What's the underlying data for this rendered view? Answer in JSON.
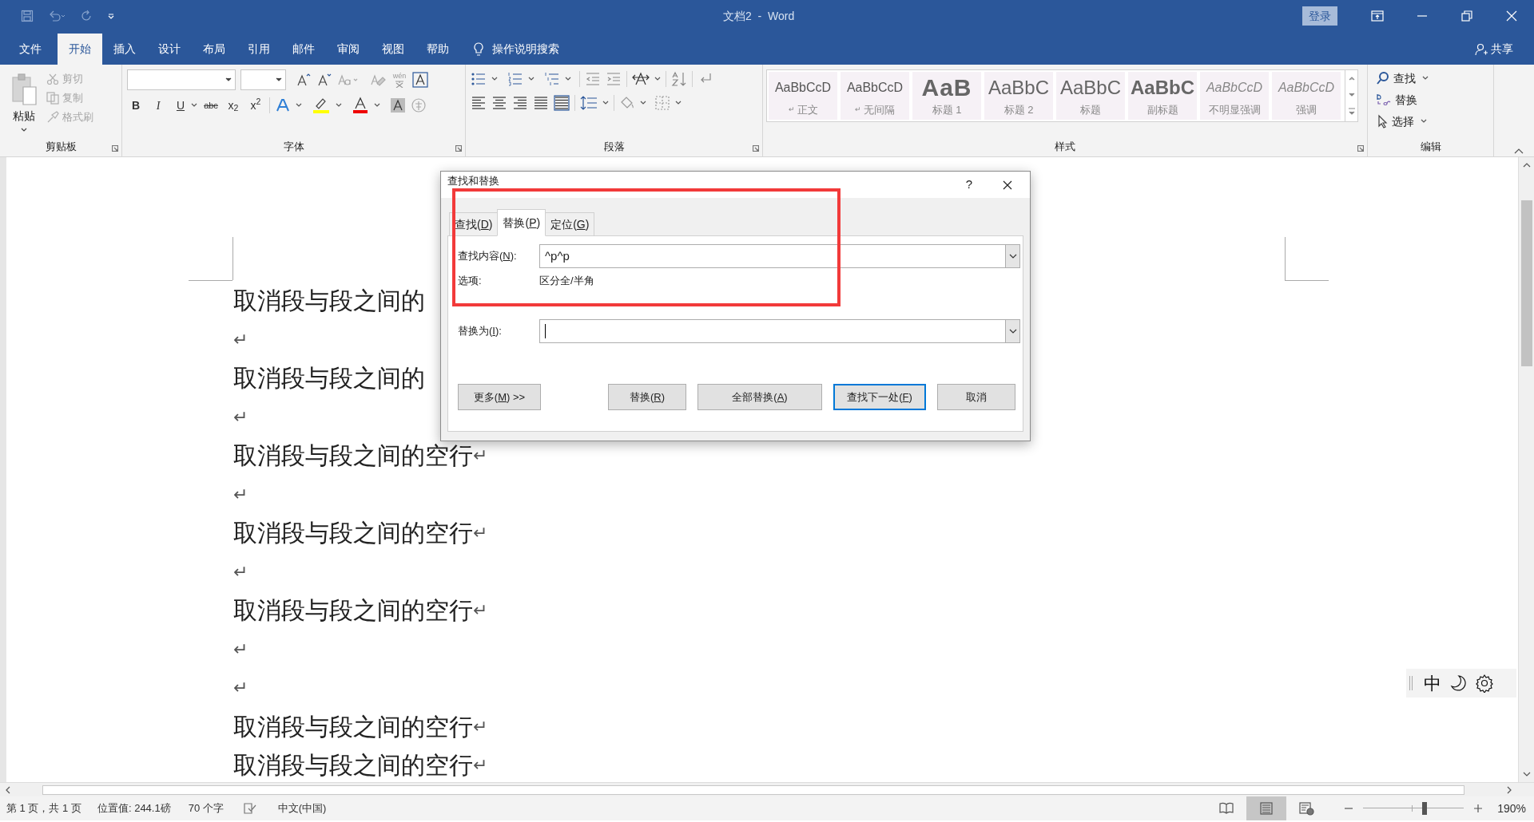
{
  "window": {
    "title": "文档2  -  Word",
    "sign_in": "登录"
  },
  "menu_tabs": [
    {
      "label": "文件",
      "selected": false
    },
    {
      "label": "开始",
      "selected": true
    },
    {
      "label": "插入",
      "selected": false
    },
    {
      "label": "设计",
      "selected": false
    },
    {
      "label": "布局",
      "selected": false
    },
    {
      "label": "引用",
      "selected": false
    },
    {
      "label": "邮件",
      "selected": false
    },
    {
      "label": "审阅",
      "selected": false
    },
    {
      "label": "视图",
      "selected": false
    },
    {
      "label": "帮助",
      "selected": false
    }
  ],
  "tell_me": "操作说明搜索",
  "share": "共享",
  "clipboard": {
    "label": "剪贴板",
    "paste": "粘贴",
    "items": [
      {
        "label": "剪切",
        "disabled": true
      },
      {
        "label": "复制",
        "disabled": true
      },
      {
        "label": "格式刷",
        "disabled": true
      }
    ]
  },
  "font": {
    "label": "字体",
    "pinyin": "wén",
    "format_buttons": [
      "B",
      "I",
      "U",
      "abc",
      "x$_{2}$",
      "x$^{2}$"
    ]
  },
  "paragraph": {
    "label": "段落"
  },
  "styles": {
    "label": "样式",
    "items": [
      {
        "preview": "AaBbCcD",
        "name": "正文",
        "mark": "↵",
        "kind": "normal"
      },
      {
        "preview": "AaBbCcD",
        "name": "无间隔",
        "mark": "↵",
        "kind": "normal"
      },
      {
        "preview": "AaB",
        "name": "标题 1",
        "kind": "heading1"
      },
      {
        "preview": "AaBbC",
        "name": "标题 2",
        "kind": "heading2"
      },
      {
        "preview": "AaBbC",
        "name": "标题",
        "kind": "heading2"
      },
      {
        "preview": "AaBbC",
        "name": "副标题",
        "kind": "subtitle"
      },
      {
        "preview": "AaBbCcD",
        "name": "不明显强调",
        "kind": "italic"
      },
      {
        "preview": "AaBbCcD",
        "name": "强调",
        "kind": "italic"
      }
    ]
  },
  "editing": {
    "label": "编辑",
    "items": [
      {
        "kind": "find",
        "label": "查找",
        "dropdown": true
      },
      {
        "kind": "replace",
        "label": "替换",
        "dropdown": false
      },
      {
        "kind": "select",
        "label": "选择",
        "dropdown": true
      }
    ]
  },
  "document": {
    "lines": [
      {
        "text": "取消段与段之间的"
      },
      {
        "mark": "↵"
      },
      {
        "text": "取消段与段之间的"
      },
      {
        "mark": "↵"
      },
      {
        "text": "取消段与段之间的空行",
        "mark": "↵"
      },
      {
        "mark": "↵"
      },
      {
        "text": "取消段与段之间的空行",
        "mark": "↵"
      },
      {
        "mark": "↵"
      },
      {
        "text": "取消段与段之间的空行",
        "mark": "↵"
      },
      {
        "mark": "↵"
      },
      {
        "mark": "↵"
      },
      {
        "text": "取消段与段之间的空行",
        "mark": "↵"
      },
      {
        "text": "取消段与段之间的空行",
        "mark": "↵"
      }
    ]
  },
  "dialog": {
    "title": "查找和替换",
    "help": "?",
    "tabs": [
      {
        "pre": "查找(",
        "key": "D",
        "post": ")",
        "selected": false
      },
      {
        "pre": "替换(",
        "key": "P",
        "post": ")",
        "selected": true
      },
      {
        "pre": "定位(",
        "key": "G",
        "post": ")",
        "selected": false
      }
    ],
    "find": {
      "pre": "查找内容(",
      "key": "N",
      "post": "):",
      "value": "^p^p"
    },
    "options": {
      "label": "选项:",
      "value": "区分全/半角"
    },
    "replace": {
      "pre": "替换为(",
      "key": "I",
      "post": "):",
      "focused": true
    },
    "buttons": [
      {
        "pre": "更多(",
        "key": "M",
        "post": ") >>",
        "default": false
      },
      {
        "pre": "替换(",
        "key": "R",
        "post": ")",
        "default": false
      },
      {
        "pre": "全部替换(",
        "key": "A",
        "post": ")",
        "default": false
      },
      {
        "pre": "查找下一处(",
        "key": "F",
        "post": ")",
        "default": true
      },
      {
        "pre": "取消",
        "default": false
      }
    ]
  },
  "status_bar": {
    "page": "第 1 页，共 1 页",
    "position": "位置值: 244.1磅",
    "words": "70 个字",
    "language": "中文(中国)",
    "views": [
      {
        "kind": "read",
        "selected": false
      },
      {
        "kind": "print",
        "selected": true
      },
      {
        "kind": "web",
        "selected": false
      }
    ],
    "zoom": {
      "level": 0.61,
      "reading": "190%"
    }
  },
  "ime_bar": {
    "mode": "中"
  }
}
